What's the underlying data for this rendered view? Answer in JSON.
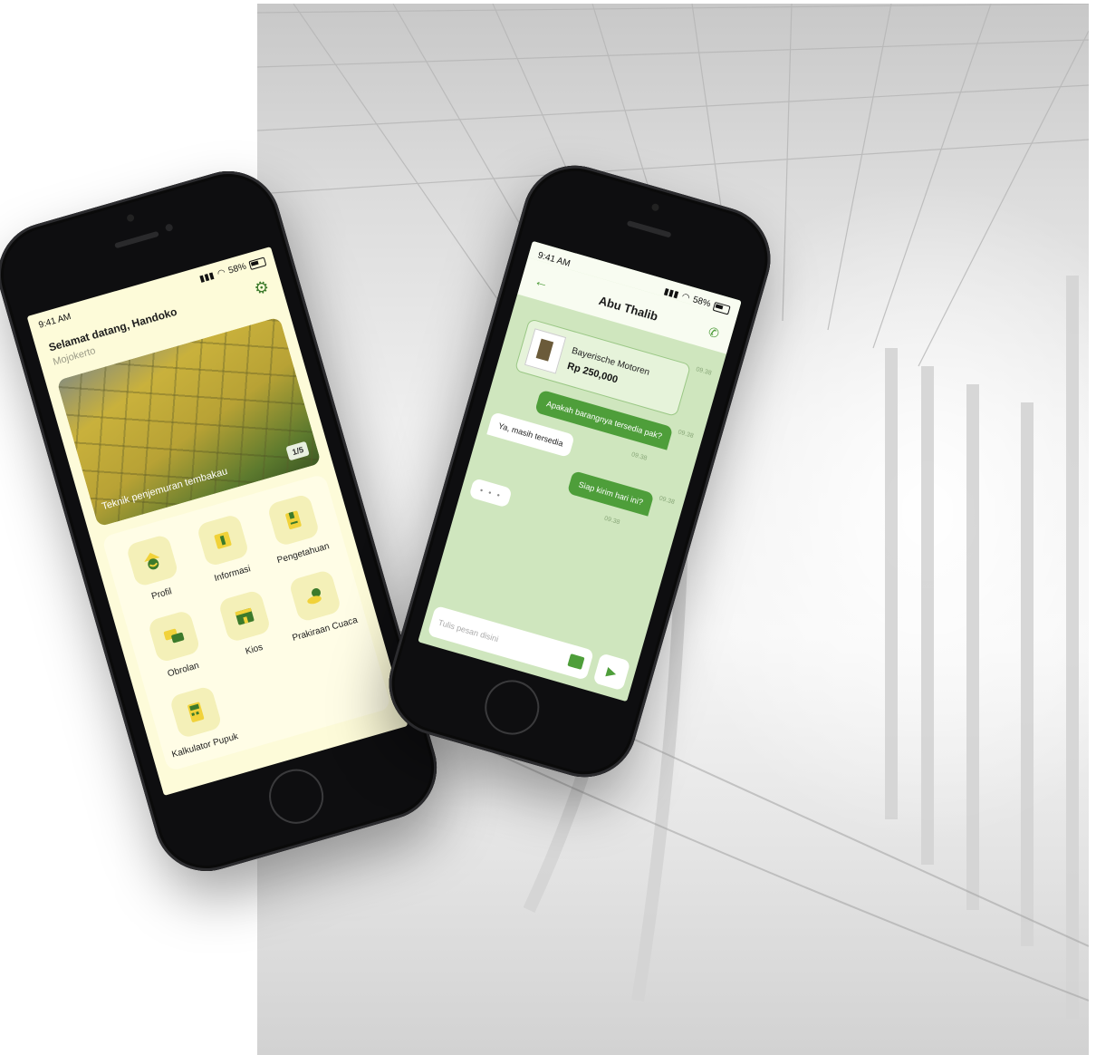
{
  "home": {
    "status": {
      "time": "9:41 AM",
      "battery": "58%"
    },
    "greeting": "Selamat datang, Handoko",
    "location": "Mojokerto",
    "banner": {
      "caption": "Teknik penjemuran tembakau",
      "pager": "1/5"
    },
    "menu": [
      {
        "label": "Profil",
        "icon": "user-helmet-icon"
      },
      {
        "label": "Informasi",
        "icon": "info-icon"
      },
      {
        "label": "Pengetahuan",
        "icon": "book-icon"
      },
      {
        "label": "Obrolan",
        "icon": "chat-icon"
      },
      {
        "label": "Kios",
        "icon": "store-icon"
      },
      {
        "label": "Prakiraan Cuaca",
        "icon": "weather-icon"
      },
      {
        "label": "Kalkulator Pupuk",
        "icon": "calculator-icon"
      }
    ]
  },
  "chat": {
    "status": {
      "time": "9:41 AM",
      "battery": "58%"
    },
    "contact": "Abu Thalib",
    "product": {
      "name": "Bayerische Motoren",
      "price": "Rp 250,000",
      "time": "09.38"
    },
    "messages": [
      {
        "from": "me",
        "text": "Apakah barangnya tersedia pak?",
        "time": "09.38"
      },
      {
        "from": "them",
        "text": "Ya, masih tersedia",
        "time": "09.38"
      },
      {
        "from": "me",
        "text": "Siap kirim hari ini?",
        "time": "09.38"
      }
    ],
    "typing": "• • •",
    "typing_time": "09.38",
    "composer_placeholder": "Tulis pesan disini"
  },
  "colors": {
    "accent": "#4e9e3a",
    "home_bg": "#fdfbd9",
    "chat_bg": "#cfe6be",
    "icon_yellow": "#f1d23a"
  }
}
